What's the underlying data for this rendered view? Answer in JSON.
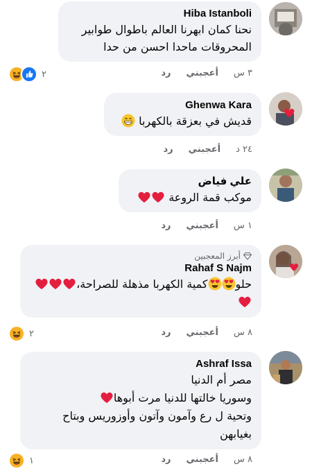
{
  "comments": [
    {
      "author": "Hiba Istanboli",
      "badge": "",
      "lines": [
        "نحنا كمان ابهرنا العالم باطوال طوابير",
        "المحروقات ماحدا احسن من حدا"
      ],
      "time": "٣ س",
      "like_label": "أعجبني",
      "reply_label": "رد",
      "reaction_count": "٢",
      "reactions": [
        "haha",
        "like"
      ]
    },
    {
      "author": "Ghenwa Kara",
      "badge": "",
      "lines": [
        "قديش في بعزقة بالكهربا"
      ],
      "time": "٢٤ د",
      "like_label": "أعجبني",
      "reply_label": "رد",
      "reaction_count": "",
      "reactions": []
    },
    {
      "author": "علي فياض",
      "badge": "",
      "lines": [
        "موكب قمة الروعة"
      ],
      "time": "١ س",
      "like_label": "أعجبني",
      "reply_label": "رد",
      "reaction_count": "",
      "reactions": []
    },
    {
      "author": "Rahaf S Najm",
      "badge": "أبرز المعجبين",
      "lines": [
        "حلو",
        "كمية الكهربا مذهلة للصراحة،"
      ],
      "time": "٨ س",
      "like_label": "أعجبني",
      "reply_label": "رد",
      "reaction_count": "٢",
      "reactions": [
        "haha"
      ]
    },
    {
      "author": "Ashraf Issa",
      "badge": "",
      "lines": [
        "مصر أم الدنيا",
        "وسوريا خالتها للدنيا مرت أبوها",
        "وتحية ل رع وآمون وآتون وأوزوريس وبتاح",
        "بغيابهن"
      ],
      "time": "٨ س",
      "like_label": "أعجبني",
      "reply_label": "رد",
      "reaction_count": "١",
      "reactions": [
        "haha"
      ]
    }
  ],
  "colors": {
    "bubble": "#f0f2f5",
    "meta": "#65676b",
    "like_blue": "#1877f2",
    "haha_yellow": "#f7b125",
    "heart_red": "#e41e3f"
  }
}
